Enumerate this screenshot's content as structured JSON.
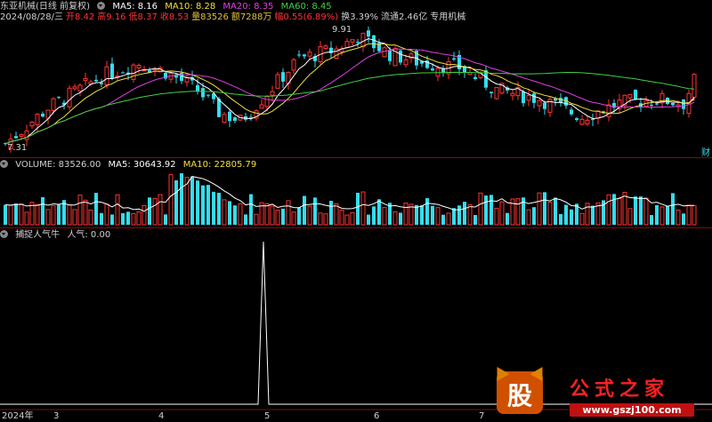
{
  "main": {
    "title": "东亚机械(日线 前复权)",
    "ma": [
      {
        "label": "MA5: 8.16",
        "color": "#ffffff"
      },
      {
        "label": "MA10: 8.28",
        "color": "#f0e040"
      },
      {
        "label": "MA20: 8.35",
        "color": "#e040e0"
      },
      {
        "label": "MA60: 8.45",
        "color": "#40d040"
      }
    ],
    "date": "2024/08/28/三",
    "quote": [
      {
        "label": "开",
        "value": "8.42",
        "color": "#ff3333"
      },
      {
        "label": "高",
        "value": "9.16",
        "color": "#ff3333"
      },
      {
        "label": "低",
        "value": "8.37",
        "color": "#ff3333"
      },
      {
        "label": "收",
        "value": "8.53",
        "color": "#ff3333"
      },
      {
        "label": "量",
        "value": "83526",
        "color": "#e0c040"
      },
      {
        "label": "额",
        "value": "7288万",
        "color": "#e0c040"
      },
      {
        "label": "幅",
        "value": "0.55(6.89%)",
        "color": "#ff3333"
      },
      {
        "label": "换",
        "value": "3.39%",
        "color": "#d0d0d0"
      },
      {
        "label": "流通",
        "value": "2.46亿",
        "color": "#d0d0d0"
      },
      {
        "label": "",
        "value": "专用机械",
        "color": "#d0d0d0"
      }
    ],
    "high_label": "9.91",
    "low_label": "7.31",
    "marker_label": "财"
  },
  "volume": {
    "title": "VOLUME: 83526.00",
    "ma5": "MA5: 30643.92",
    "ma10": "MA10: 22805.79"
  },
  "indicator": {
    "title": "捕捉人气牛",
    "value": "人气: 0.00"
  },
  "xaxis": {
    "year": "2024年",
    "ticks": [
      "3",
      "4",
      "5",
      "6",
      "7"
    ]
  },
  "watermark": {
    "logo": "股",
    "name": "公式之家",
    "url": "www.gszj100.com"
  },
  "colors": {
    "up": "#ff3333",
    "down": "#33ddee",
    "grid": "#7a1010"
  }
}
